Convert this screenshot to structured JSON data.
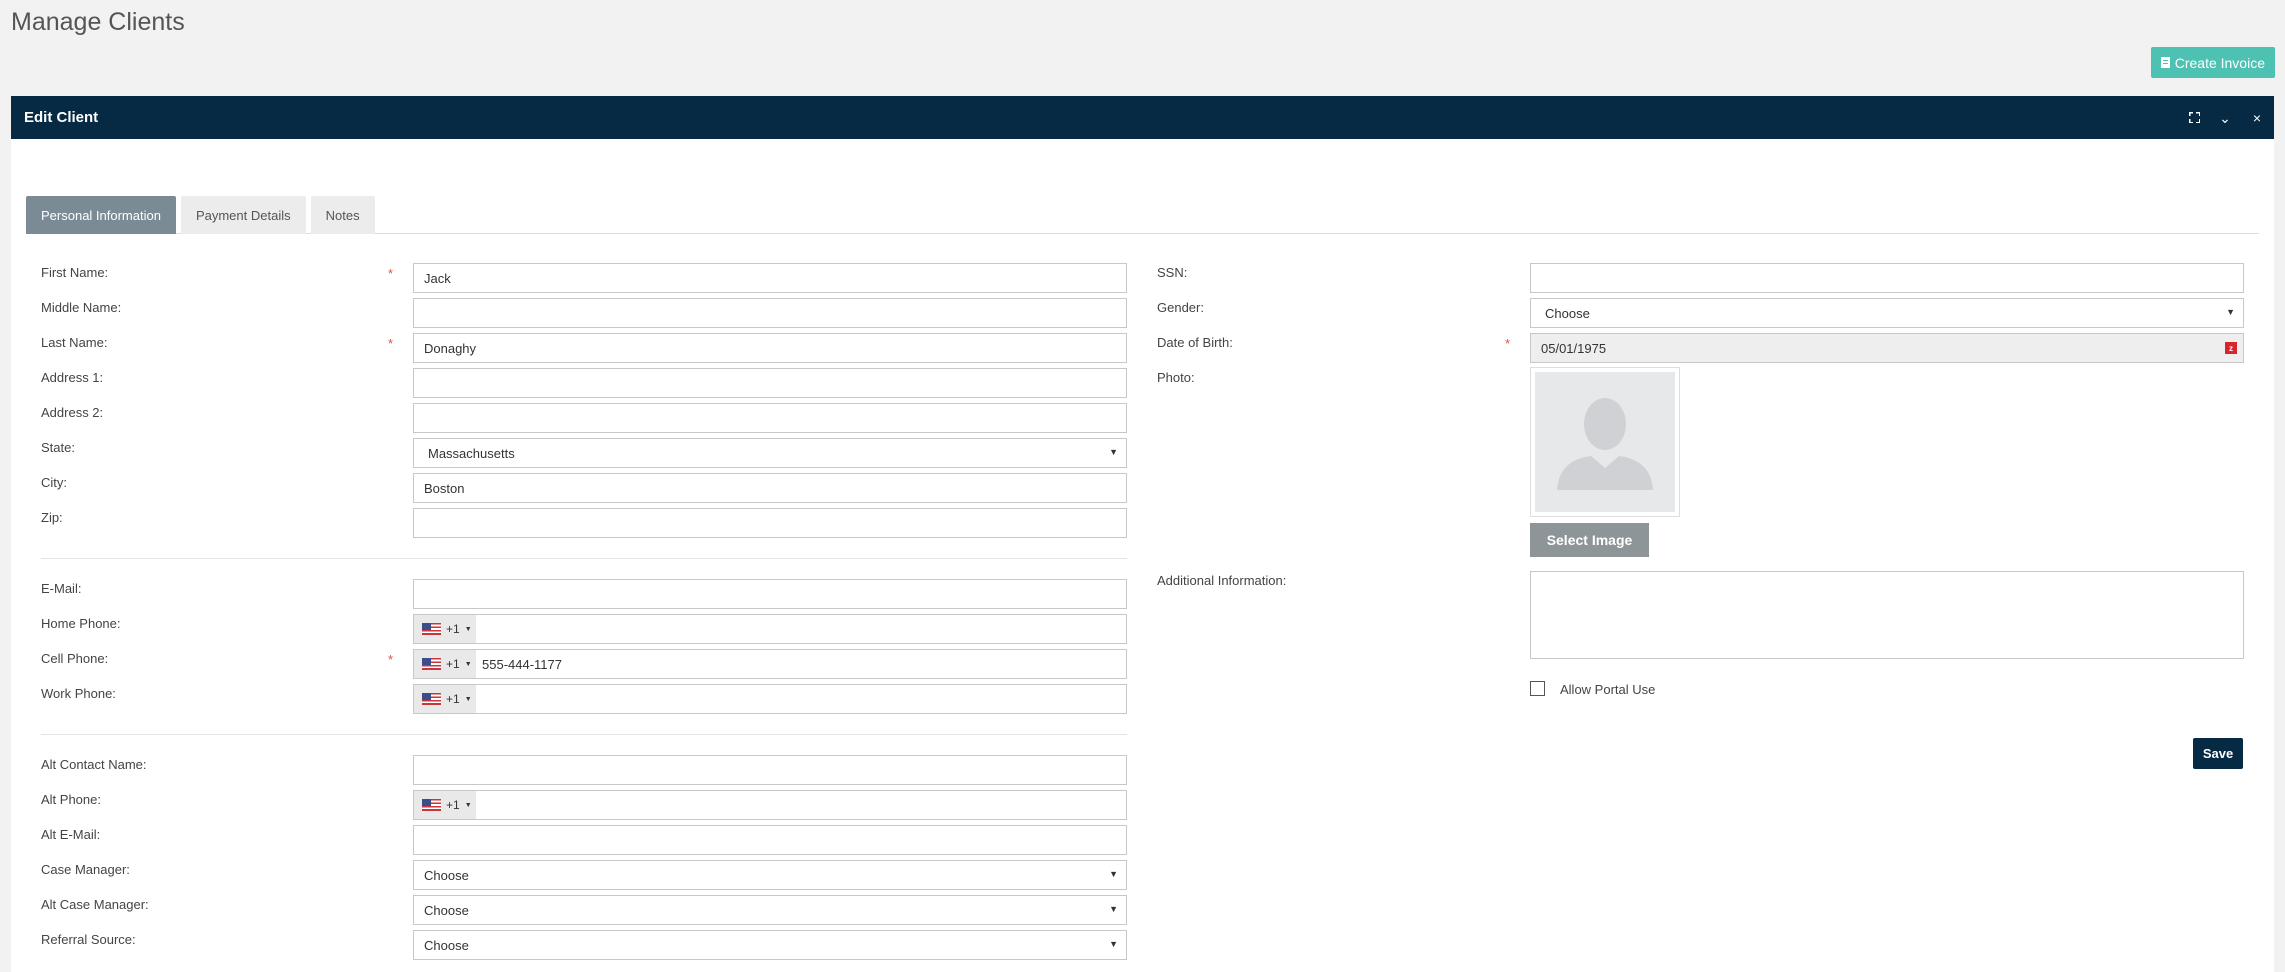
{
  "page": {
    "title": "Manage Clients",
    "create_invoice_label": "Create Invoice"
  },
  "panel": {
    "title": "Edit Client",
    "controls": {
      "collapse": "⌄",
      "close": "×"
    }
  },
  "tabs": [
    {
      "label": "Personal Information",
      "active": true
    },
    {
      "label": "Payment Details",
      "active": false
    },
    {
      "label": "Notes",
      "active": false
    }
  ],
  "left": {
    "first_name": {
      "label": "First Name:",
      "value": "Jack",
      "required": true
    },
    "middle_name": {
      "label": "Middle Name:",
      "value": ""
    },
    "last_name": {
      "label": "Last Name:",
      "value": "Donaghy",
      "required": true
    },
    "address1": {
      "label": "Address 1:",
      "value": ""
    },
    "address2": {
      "label": "Address 2:",
      "value": ""
    },
    "state": {
      "label": "State:",
      "value": "Massachusetts"
    },
    "city": {
      "label": "City:",
      "value": "Boston"
    },
    "zip": {
      "label": "Zip:",
      "value": ""
    },
    "email": {
      "label": "E-Mail:",
      "value": ""
    },
    "home_phone": {
      "label": "Home Phone:",
      "code": "+1",
      "value": ""
    },
    "cell_phone": {
      "label": "Cell Phone:",
      "code": "+1",
      "value": "555-444-1177",
      "required": true
    },
    "work_phone": {
      "label": "Work Phone:",
      "code": "+1",
      "value": ""
    },
    "alt_contact_name": {
      "label": "Alt Contact Name:",
      "value": ""
    },
    "alt_phone": {
      "label": "Alt Phone:",
      "code": "+1",
      "value": ""
    },
    "alt_email": {
      "label": "Alt E-Mail:",
      "value": ""
    },
    "case_manager": {
      "label": "Case Manager:",
      "value": "Choose"
    },
    "alt_case_manager": {
      "label": "Alt Case Manager:",
      "value": "Choose"
    },
    "referral_source": {
      "label": "Referral Source:",
      "value": "Choose"
    }
  },
  "right": {
    "ssn": {
      "label": "SSN:",
      "value": ""
    },
    "gender": {
      "label": "Gender:",
      "value": "Choose"
    },
    "dob": {
      "label": "Date of Birth:",
      "value": "05/01/1975",
      "required": true
    },
    "photo": {
      "label": "Photo:"
    },
    "select_image_label": "Select Image",
    "additional_info": {
      "label": "Additional Information:",
      "value": ""
    },
    "allow_portal": {
      "label": "Allow Portal Use",
      "checked": false
    },
    "save_label": "Save"
  },
  "required_mark": "*",
  "colors": {
    "header_bg": "#062a44",
    "accent_teal": "#4dc2b3",
    "active_tab": "#7a8b96",
    "required": "#d9534f"
  }
}
